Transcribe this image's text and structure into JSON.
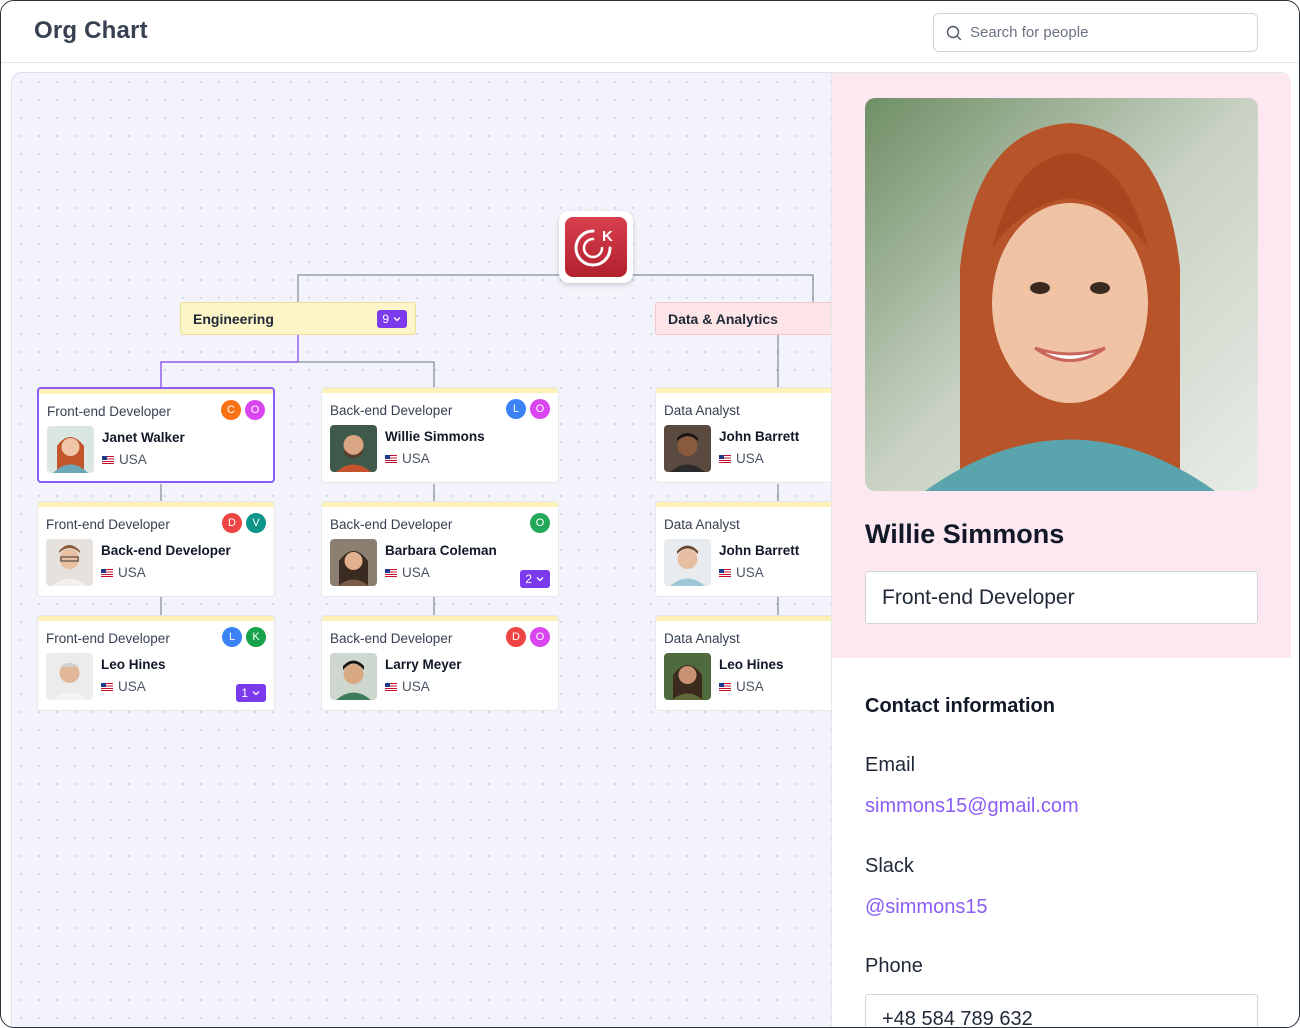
{
  "header": {
    "title": "Org Chart",
    "search_placeholder": "Search for people"
  },
  "chart": {
    "root_logo_letter": "K",
    "departments": [
      {
        "name": "Engineering",
        "count": "9",
        "color": "#fcf5c7"
      },
      {
        "name": "Data & Analytics",
        "color": "#fde4e6"
      }
    ],
    "cards": [
      {
        "role": "Front-end Developer",
        "name": "Janet Walker",
        "country": "USA",
        "badges": [
          {
            "letter": "C",
            "color": "#f97316"
          },
          {
            "letter": "O",
            "color": "#d946ef"
          }
        ],
        "selected": true
      },
      {
        "role": "Front-end Developer",
        "name": "Back-end Developer",
        "country": "USA",
        "badges": [
          {
            "letter": "D",
            "color": "#ef4444"
          },
          {
            "letter": "V",
            "color": "#0d9488"
          }
        ]
      },
      {
        "role": "Front-end Developer",
        "name": "Leo Hines",
        "country": "USA",
        "badges": [
          {
            "letter": "L",
            "color": "#3b82f6"
          },
          {
            "letter": "K",
            "color": "#16a34a"
          }
        ],
        "count": "1"
      },
      {
        "role": "Back-end Developer",
        "name": "Willie Simmons",
        "country": "USA",
        "badges": [
          {
            "letter": "L",
            "color": "#3b82f6"
          },
          {
            "letter": "O",
            "color": "#d946ef"
          }
        ]
      },
      {
        "role": "Back-end Developer",
        "name": "Barbara Coleman",
        "country": "USA",
        "badges": [
          {
            "letter": "O",
            "color": "#22a85a"
          }
        ],
        "count": "2"
      },
      {
        "role": "Back-end Developer",
        "name": "Larry Meyer",
        "country": "USA",
        "badges": [
          {
            "letter": "D",
            "color": "#ef4444"
          },
          {
            "letter": "O",
            "color": "#d946ef"
          }
        ]
      },
      {
        "role": "Data Analyst",
        "name": "John Barrett",
        "country": "USA"
      },
      {
        "role": "Data Analyst",
        "name": "John Barrett",
        "country": "USA"
      },
      {
        "role": "Data Analyst",
        "name": "Leo Hines",
        "country": "USA"
      }
    ]
  },
  "profile": {
    "name": "Willie Simmons",
    "role": "Front-end Developer",
    "contact_heading": "Contact information",
    "email_label": "Email",
    "email": "simmons15@gmail.com",
    "slack_label": "Slack",
    "slack": "@simmons15",
    "phone_label": "Phone",
    "phone": "+48 584 789 632"
  }
}
